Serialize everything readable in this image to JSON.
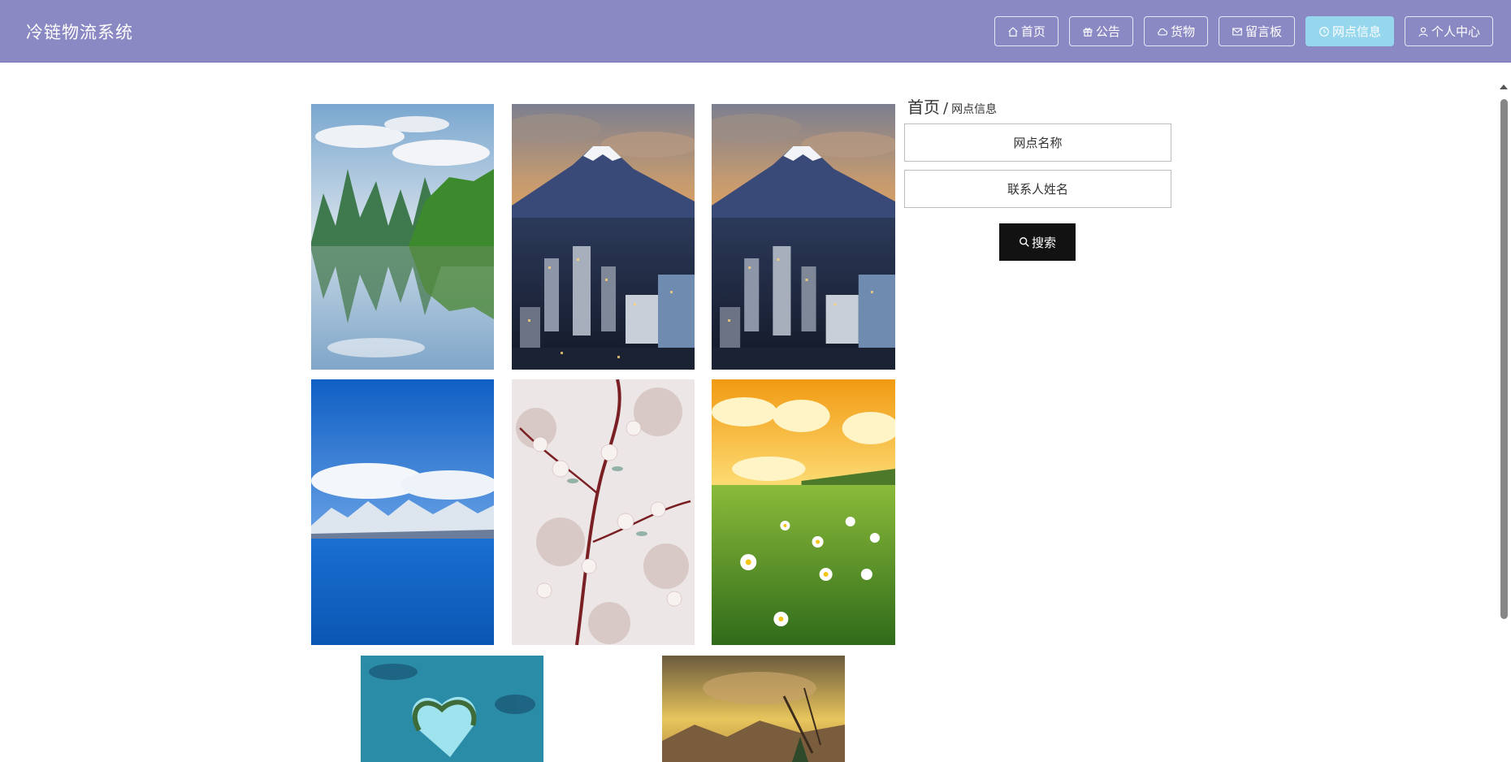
{
  "header": {
    "title": "冷链物流系统",
    "nav": [
      {
        "label": "首页",
        "icon": "home-icon"
      },
      {
        "label": "公告",
        "icon": "gift-icon"
      },
      {
        "label": "货物",
        "icon": "cloud-icon"
      },
      {
        "label": "留言板",
        "icon": "mail-icon"
      },
      {
        "label": "网点信息",
        "icon": "clock-icon",
        "active": true
      },
      {
        "label": "个人中心",
        "icon": "user-icon"
      }
    ],
    "colors": {
      "bar": "#8b89c3",
      "active": "#97d7ee"
    }
  },
  "breadcrumb": {
    "home": "首页",
    "separator": "/",
    "current": "网点信息"
  },
  "search": {
    "name_placeholder": "网点名称",
    "contact_placeholder": "联系人姓名",
    "button_label": "搜索",
    "button_icon": "search-icon"
  },
  "gallery": [
    {
      "depicts": "karst-mountain-lake-reflection"
    },
    {
      "depicts": "mount-fuji-city-night"
    },
    {
      "depicts": "mount-fuji-city-night"
    },
    {
      "depicts": "snowy-mountains-blue-lake"
    },
    {
      "depicts": "cherry-blossom-branch"
    },
    {
      "depicts": "daisy-meadow-sunset"
    },
    {
      "depicts": "heart-shaped-island"
    },
    {
      "depicts": "golden-valley-sunrise"
    }
  ]
}
